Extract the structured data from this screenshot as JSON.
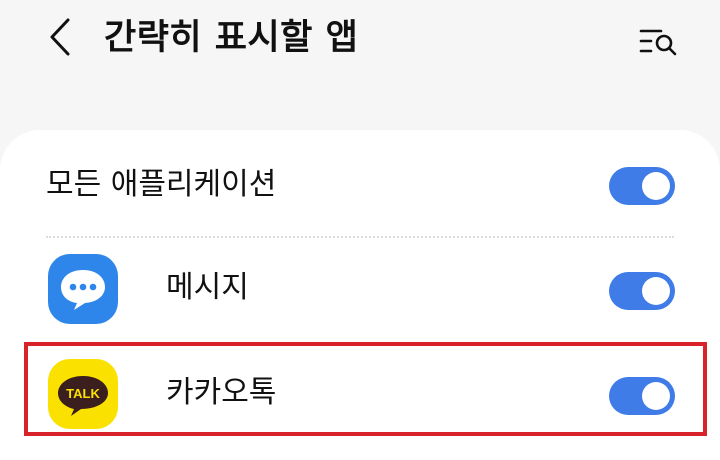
{
  "header": {
    "title": "간략히 표시할 앱",
    "back_icon": "chevron-left-icon",
    "search_icon": "list-search-icon"
  },
  "settings": {
    "all_apps_label": "모든 애플리케이션",
    "all_apps_enabled": true
  },
  "apps": [
    {
      "label": "메시지",
      "icon": "messages-icon",
      "enabled": true
    },
    {
      "label": "카카오톡",
      "icon": "kakaotalk-icon",
      "icon_text": "TALK",
      "enabled": true
    }
  ],
  "colors": {
    "toggle_on": "#3f7ce8",
    "highlight": "#d8232a",
    "messages_blue": "#2f86ea",
    "kakao_yellow": "#fae100",
    "kakao_brown": "#3b1e1e"
  }
}
